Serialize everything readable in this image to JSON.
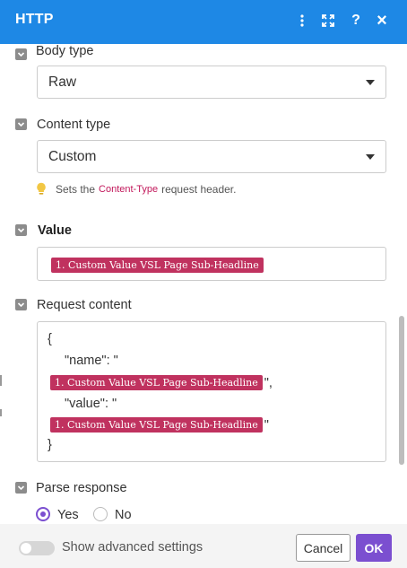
{
  "header": {
    "title": "HTTP",
    "icons": [
      "more-vertical-icon",
      "expand-icon",
      "help-icon",
      "close-icon"
    ],
    "help_glyph": "?",
    "close_glyph": "×",
    "color": "#1e88e5"
  },
  "body_type": {
    "label": "Body type",
    "value": "Raw"
  },
  "content_type": {
    "label": "Content type",
    "value": "Custom",
    "hint_prefix": "Sets the",
    "hint_code": "Content-Type",
    "hint_suffix": "request header."
  },
  "value_field": {
    "label": "Value",
    "pill": "1. Custom Value VSL Page Sub-Headline"
  },
  "request_content": {
    "label": "Request content",
    "line1": "{",
    "line2": "\"name\": \"",
    "pill1": "1. Custom Value VSL Page Sub-Headline",
    "after_pill1": "\",",
    "line4": "\"value\": \"",
    "pill2": "1. Custom Value VSL Page Sub-Headline",
    "after_pill2": "\"",
    "line6": "}"
  },
  "parse_response": {
    "label": "Parse response",
    "options": [
      "Yes",
      "No"
    ],
    "selected": "Yes"
  },
  "footer": {
    "advanced_label": "Show advanced settings",
    "cancel": "Cancel",
    "ok": "OK"
  },
  "colors": {
    "accent": "#7b4fd0",
    "pill": "#c0325f",
    "header": "#1e88e5"
  }
}
